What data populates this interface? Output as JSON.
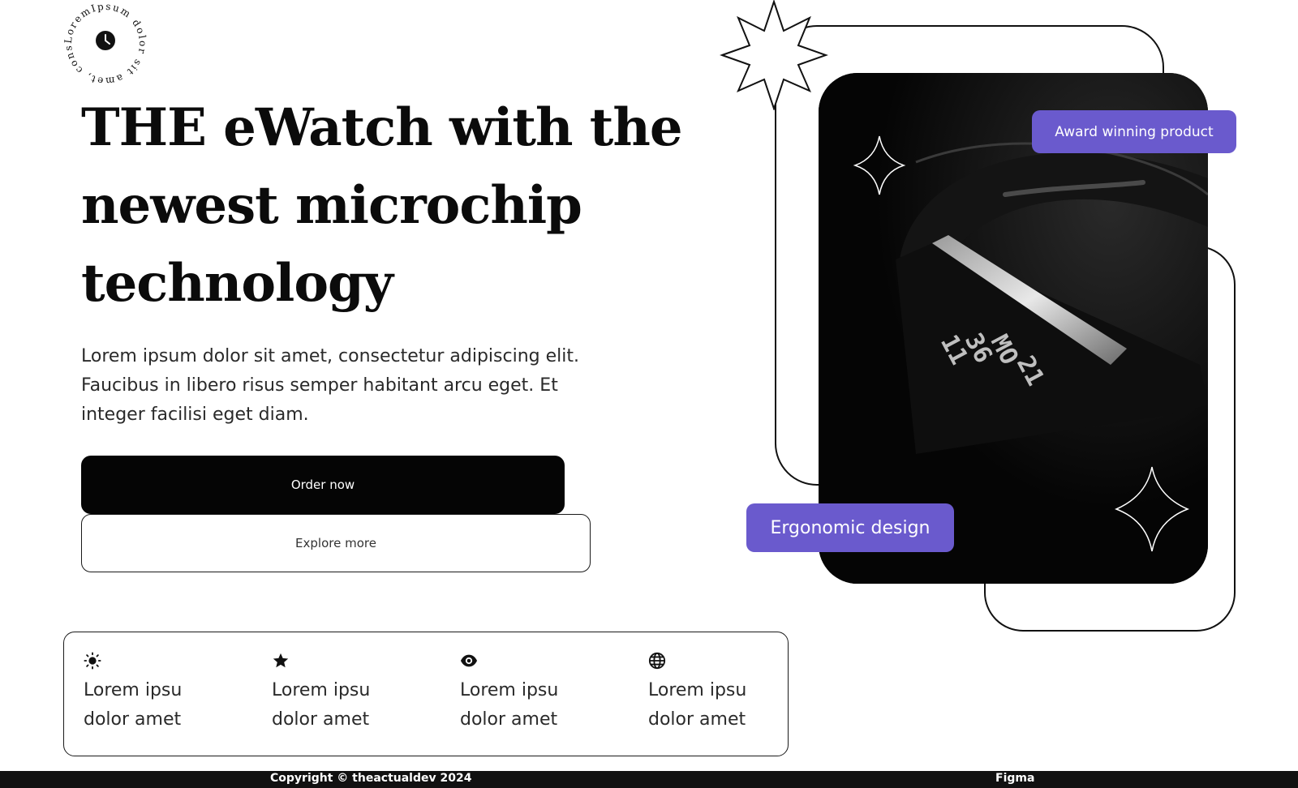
{
  "logo": {
    "ring_text": "LoremIpsum dolor sit amet, cons",
    "icon": "clock-icon"
  },
  "hero": {
    "title": "THE eWatch with the newest microchip technology",
    "description": "Lorem ipsum dolor sit amet, consectetur adipiscing elit. Faucibus in libero risus semper habitant arcu eget. Et integer facilisi eget diam.",
    "order_label": "Order now",
    "explore_label": "Explore more"
  },
  "features": [
    {
      "icon": "sun-icon",
      "text": "Lorem ipsu dolor amet"
    },
    {
      "icon": "star-icon",
      "text": "Lorem ipsu dolor amet"
    },
    {
      "icon": "eye-icon",
      "text": "Lorem ipsu dolor amet"
    },
    {
      "icon": "globe-icon",
      "text": "Lorem ipsu dolor amet"
    }
  ],
  "visual": {
    "award_badge": "Award winning product",
    "ergonomic_badge": "Ergonomic design",
    "watch_display": {
      "line1": "11",
      "line2": "36",
      "line3": "MO",
      "line4": "21"
    },
    "accent_color": "#6a5acd"
  },
  "footer": {
    "copyright": "Copyright © theactualdev 2024",
    "figma": "Figma"
  }
}
